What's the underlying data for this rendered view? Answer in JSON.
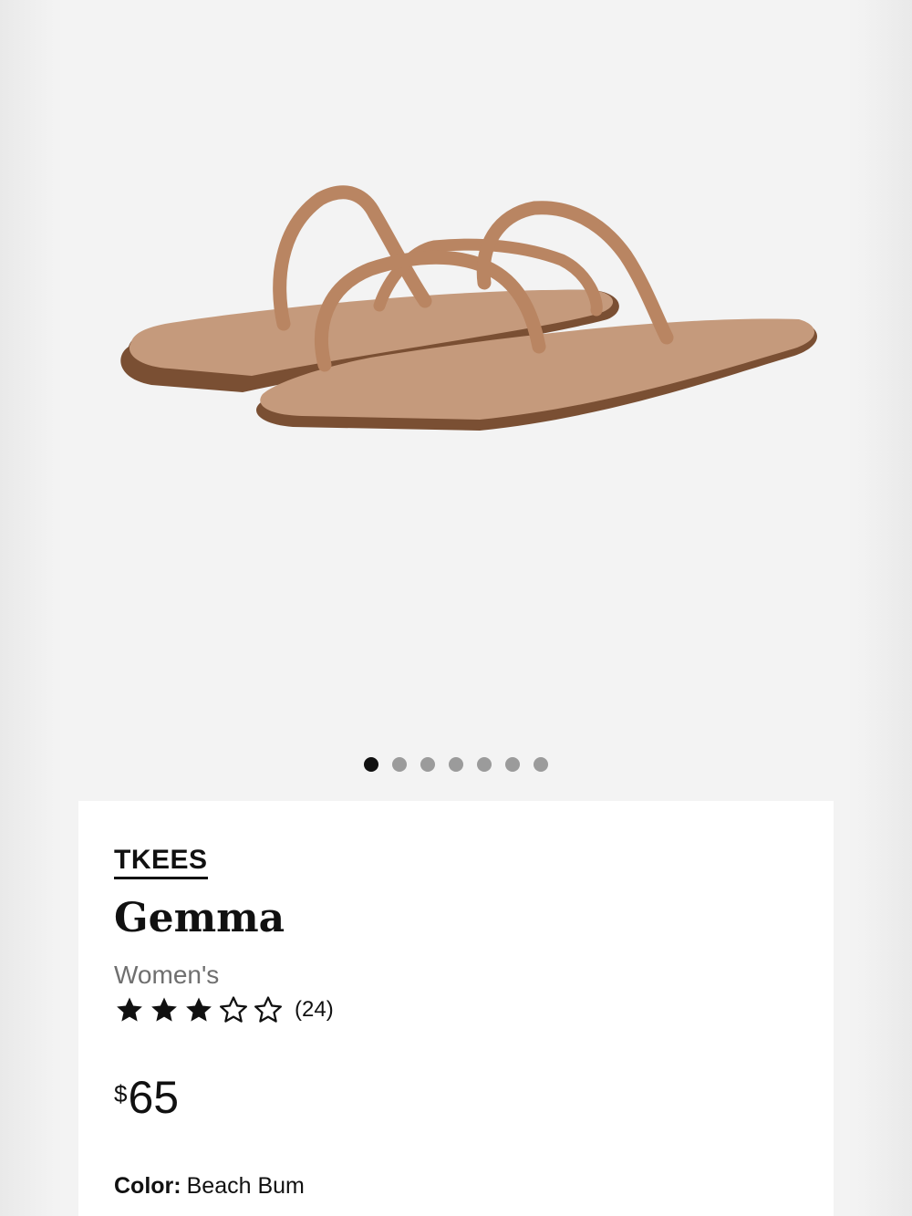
{
  "product": {
    "brand": "TKEES",
    "name": "Gemma",
    "gender": "Women's",
    "rating": 3,
    "rating_max": 5,
    "review_count": "(24)",
    "price_currency": "$",
    "price_amount": "65",
    "color_label": "Color:",
    "color_value": "Beach Bum"
  },
  "gallery": {
    "image_count": 7,
    "active_index": 0
  },
  "colors": {
    "sandal_strap": "#b98562",
    "sandal_footbed": "#c59a7c",
    "sandal_sole": "#7a4f33",
    "dot_active": "#111111",
    "dot_inactive": "#9b9b9b"
  }
}
